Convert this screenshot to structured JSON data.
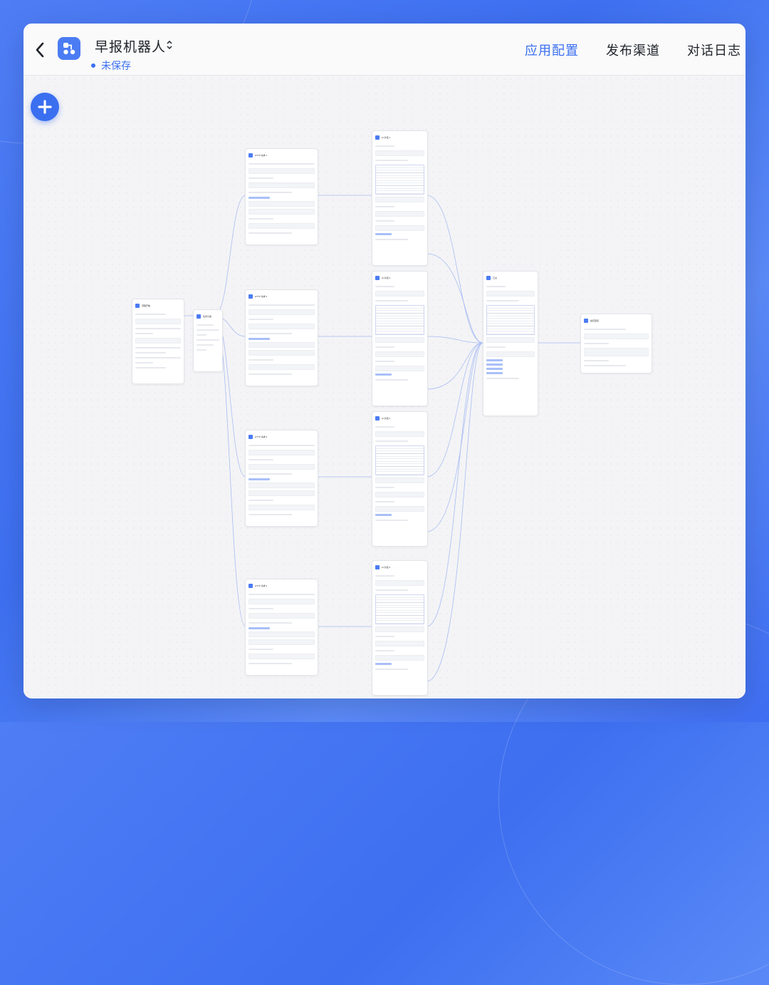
{
  "header": {
    "app_name": "早报机器人",
    "status": "未保存",
    "tabs": [
      {
        "label": "应用配置",
        "active": true
      },
      {
        "label": "发布渠道",
        "active": false
      },
      {
        "label": "对话日志",
        "active": false
      }
    ]
  },
  "colors": {
    "accent": "#3a6ff0",
    "background": "#4f7df5",
    "canvas": "#f4f4f6"
  },
  "icons": {
    "back": "back-arrow-icon",
    "app": "workflow-app-icon",
    "switch": "chevron-updown-icon",
    "add": "plus-icon"
  },
  "nodes": [
    {
      "id": "start",
      "title": "流程开始"
    },
    {
      "id": "split",
      "title": "任务分发"
    },
    {
      "id": "http1",
      "title": "HTTP 请求 1"
    },
    {
      "id": "http2",
      "title": "HTTP 请求 2"
    },
    {
      "id": "http3",
      "title": "HTTP 请求 3"
    },
    {
      "id": "http4",
      "title": "HTTP 请求 4"
    },
    {
      "id": "llm1",
      "title": "AI 对话 1"
    },
    {
      "id": "llm2",
      "title": "AI 对话 2"
    },
    {
      "id": "llm3",
      "title": "AI 对话 3"
    },
    {
      "id": "llm4",
      "title": "AI 对话 4"
    },
    {
      "id": "merge",
      "title": "汇总"
    },
    {
      "id": "reply",
      "title": "指定回复"
    }
  ]
}
